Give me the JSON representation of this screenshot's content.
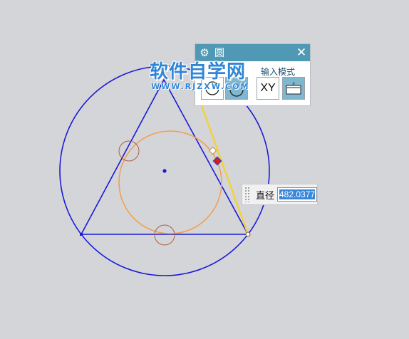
{
  "dialog": {
    "title": "圆",
    "section_label": "输入模式",
    "xy_label": "XY",
    "icons": [
      "gear-icon",
      "close-icon",
      "circle-mode-icon",
      "arc-mode-icon",
      "parameter-mode-icon"
    ]
  },
  "watermark": {
    "name": "软件自学网",
    "url": "WWW.RJZXW.COM"
  },
  "diameter": {
    "label": "直径",
    "value": "482.0377"
  },
  "colors": {
    "big_circle": "#1a1ad6",
    "triangle": "#1a1ad6",
    "inscribed_circle": "#f0a050",
    "tangent_marker": "#b06040",
    "guide_line": "#f2d23a",
    "dialog_title": "#4f99b5"
  }
}
